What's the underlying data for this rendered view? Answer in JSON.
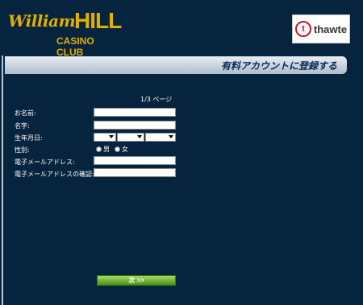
{
  "header": {
    "logo_script": "William",
    "logo_bold": "HILL",
    "logo_sub": "CASINO CLUB",
    "badge_word": "thawte",
    "badge_letter": "t"
  },
  "title": "有料アカウントに登録する",
  "page_indicator": "1/3 ページ",
  "form": {
    "name_label": "お名前:",
    "surname_label": "名字:",
    "dob_label": "生年月日:",
    "gender_label": "性別:",
    "gender_male": "男",
    "gender_female": "女",
    "email_label": "電子メールアドレス:",
    "email_confirm_label": "電子メールアドレスの確認:"
  },
  "next_button": "次 >>"
}
